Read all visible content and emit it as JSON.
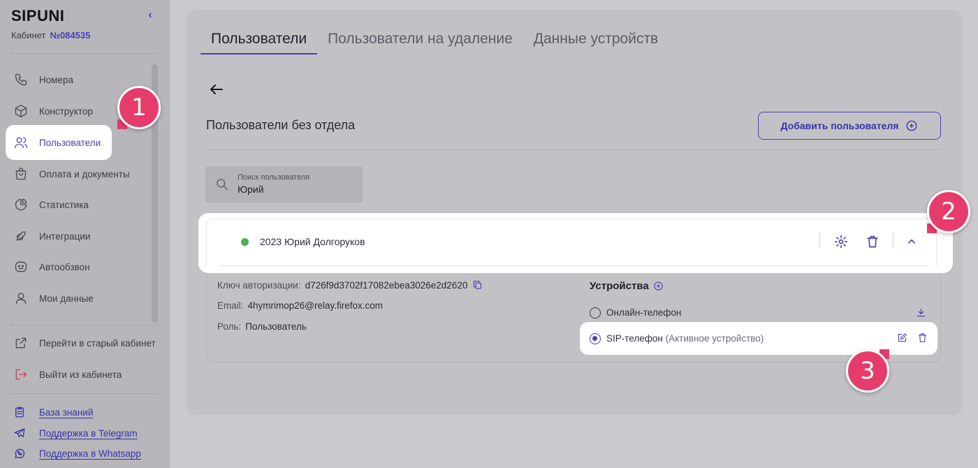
{
  "sidebar": {
    "brand": "SIPUNI",
    "collapse_icon": "chevron-left-icon",
    "cabinet_label": "Кабинет",
    "cabinet_number": "№084535",
    "items": [
      {
        "label": "Номера",
        "icon": "phone-icon"
      },
      {
        "label": "Конструктор",
        "icon": "cube-icon"
      },
      {
        "label": "Пользователи",
        "icon": "users-icon",
        "active": true
      },
      {
        "label": "Оплата и документы",
        "icon": "bag-icon"
      },
      {
        "label": "Статистика",
        "icon": "pie-chart-icon"
      },
      {
        "label": "Интеграции",
        "icon": "rocket-icon"
      },
      {
        "label": "Автообзвон",
        "icon": "robot-icon"
      },
      {
        "label": "Мои данные",
        "icon": "user-icon"
      }
    ],
    "old_cabinet": "Перейти в старый кабинет",
    "logout": "Выйти из кабинета",
    "help": [
      {
        "label": "База знаний",
        "icon": "clipboard-icon"
      },
      {
        "label": "Поддержка в Telegram",
        "icon": "telegram-icon"
      },
      {
        "label": "Поддержка в Whatsapp",
        "icon": "whatsapp-icon"
      }
    ]
  },
  "tabs": [
    "Пользователи",
    "Пользователи на удаление",
    "Данные устройств"
  ],
  "main": {
    "section_title": "Пользователи без отдела",
    "add_button": "Добавить пользователя",
    "search": {
      "placeholder": "Поиск пользователя",
      "value": "Юрий"
    },
    "user": {
      "name": "2023 Юрий Долгоруков",
      "status_color": "#4cb050",
      "auth_key_label": "Ключ авторизации:",
      "auth_key": "d726f9d3702f17082ebea3026e2d2620",
      "email_label": "Email:",
      "email": "4hymrimop26@relay.firefox.com",
      "role_label": "Роль:",
      "role": "Пользователь"
    },
    "devices": {
      "title": "Устройства",
      "online": "Онлайн-телефон",
      "sip": "SIP-телефон",
      "sip_note": "(Активное устройство)"
    }
  },
  "badges": [
    "1",
    "2",
    "3"
  ],
  "colors": {
    "accent": "#4a3fb5",
    "badge": "#e63c6b"
  }
}
